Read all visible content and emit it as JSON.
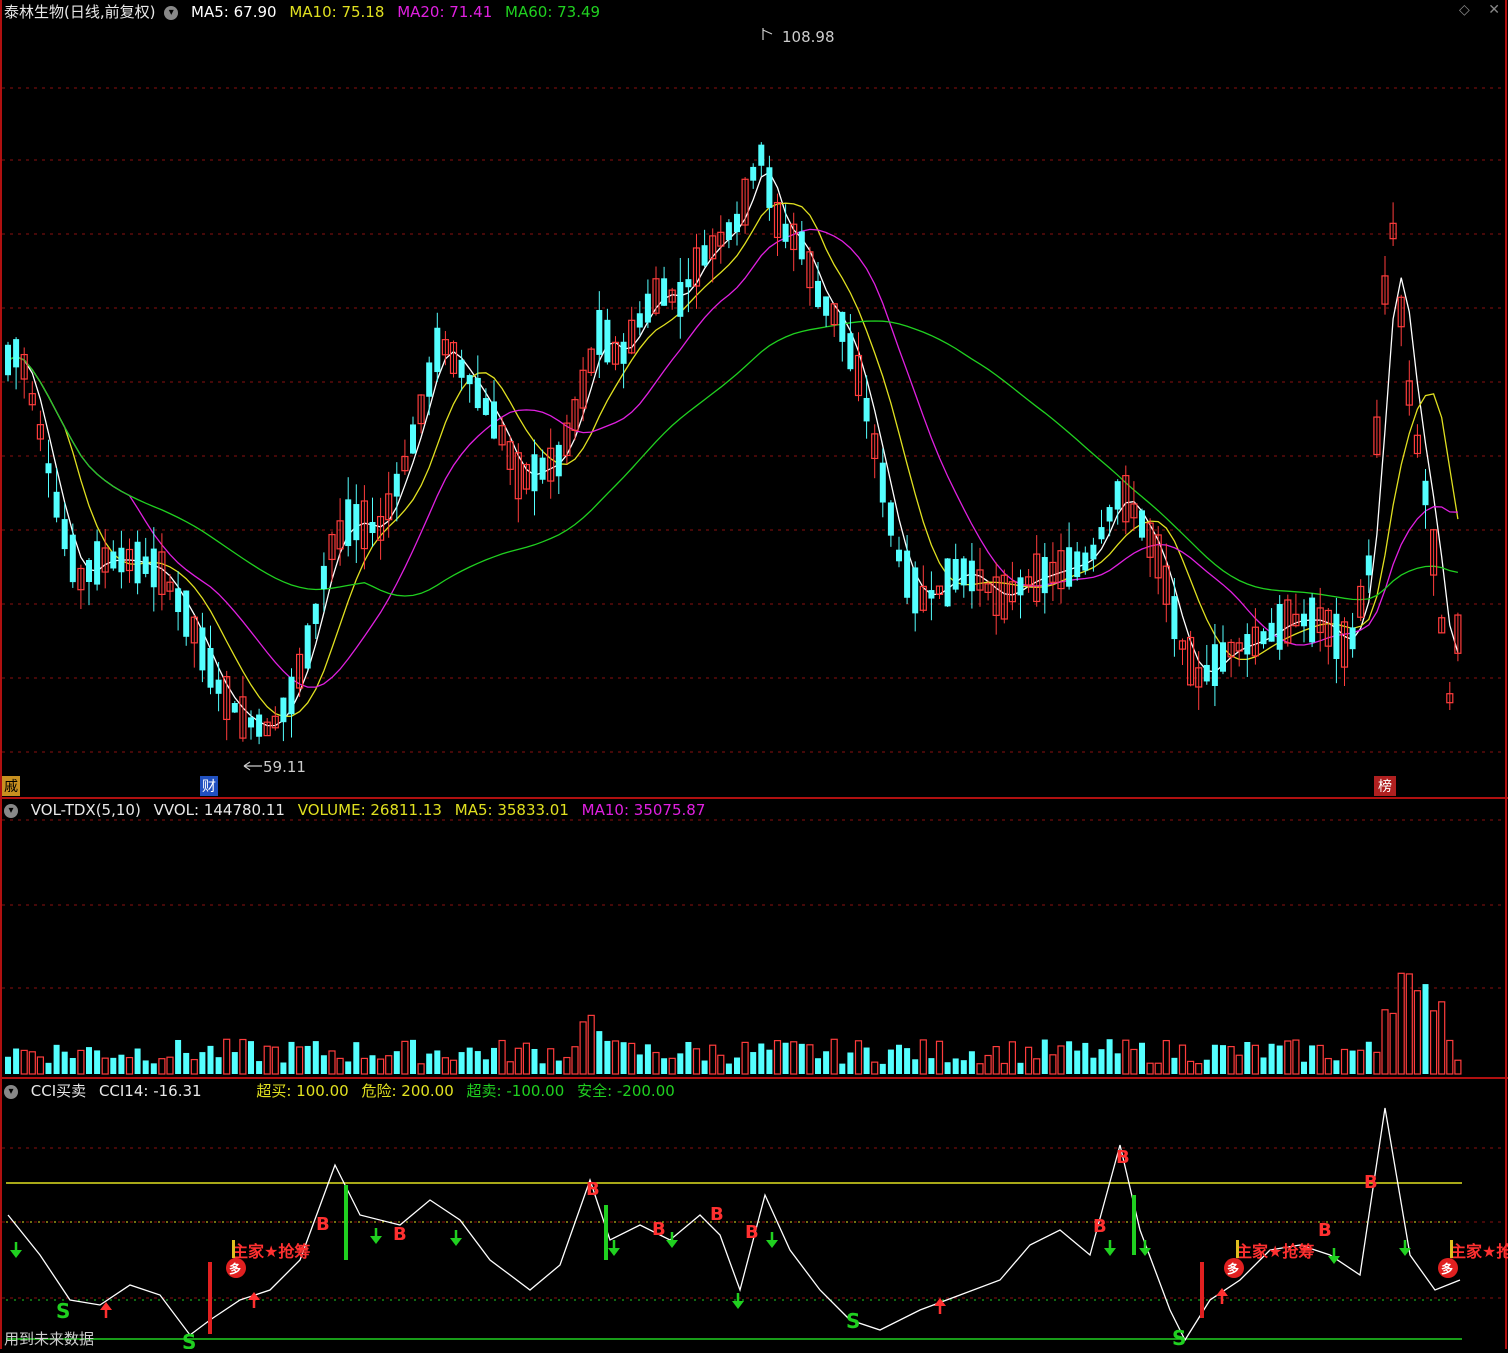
{
  "header": {
    "title": "泰林生物(日线,前复权)",
    "ma5_label": "MA5: 67.90",
    "ma10_label": "MA10: 75.18",
    "ma20_label": "MA20: 71.41",
    "ma60_label": "MA60: 73.49"
  },
  "price_annotations": {
    "high_label": "108.98",
    "low_label": "59.11",
    "left_tag": "戚",
    "cai_tag": "财",
    "bang_tag": "榜"
  },
  "volume_panel": {
    "name_label": "VOL-TDX(5,10)",
    "vvol_label": "VVOL: 144780.11",
    "volume_label": "VOLUME: 26811.13",
    "ma5_label": "MA5: 35833.01",
    "ma10_label": "MA10: 35075.87"
  },
  "cci_panel": {
    "name_label": "CCI买卖",
    "cci_label": "CCI14: -16.31",
    "overbought_label": "超买: 100.00",
    "danger_label": "危险: 200.00",
    "oversold_label": "超卖: -100.00",
    "safe_label": "安全: -200.00",
    "footer_note": "用到未来数据",
    "marker_b": "B",
    "marker_s": "S",
    "marker_duo": "多",
    "marker_main": "主家★抢筹"
  },
  "colors": {
    "up": "#ff3c3c",
    "down": "#54ffff",
    "ma5": "#ffffff",
    "ma10": "#e0e020",
    "ma20": "#e020e0",
    "ma60": "#20d020",
    "grid": "#8a1010"
  },
  "chart_data": [
    {
      "type": "candlestick",
      "title": "泰林生物(日线,前复权)",
      "high": 108.98,
      "low": 59.11,
      "ma": {
        "MA5": 67.9,
        "MA10": 75.18,
        "MA20": 71.41,
        "MA60": 73.49
      }
    },
    {
      "type": "bar",
      "title": "VOL-TDX(5,10)",
      "values": {
        "VVOL": 144780.11,
        "VOLUME": 26811.13,
        "MA5": 35833.01,
        "MA10": 35075.87
      }
    },
    {
      "type": "line",
      "title": "CCI买卖",
      "values": {
        "CCI14": -16.31
      },
      "levels": {
        "超买": 100.0,
        "危险": 200.0,
        "超卖": -100.0,
        "安全": -200.0
      }
    }
  ]
}
